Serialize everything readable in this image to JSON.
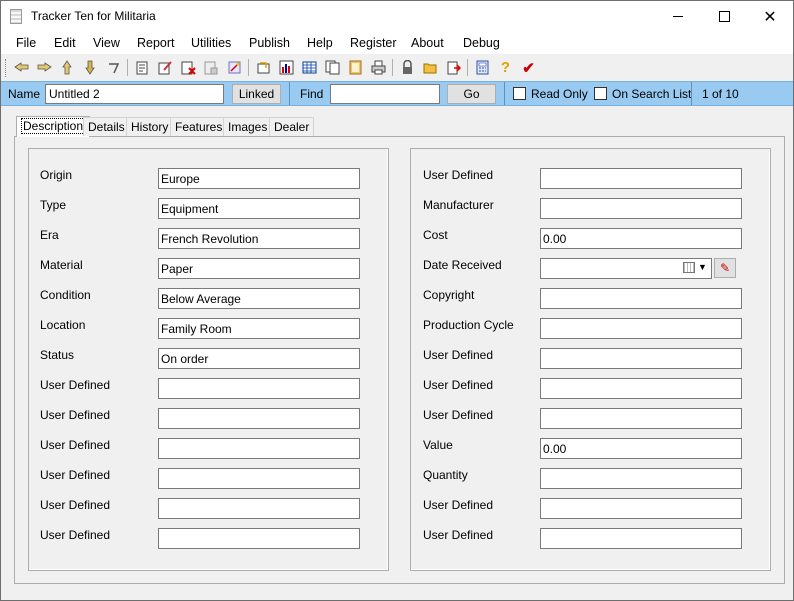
{
  "window": {
    "title": "Tracker Ten for Militaria"
  },
  "menu": [
    "File",
    "Edit",
    "View",
    "Report",
    "Utilities",
    "Publish",
    "Help",
    "Register",
    "About",
    "Debug"
  ],
  "toolbar": {
    "icons": [
      "first-record-icon",
      "previous-record-icon",
      "next-record-icon",
      "last-record-icon",
      "insert-record-icon",
      "copy-record-icon",
      "edit-record-icon",
      "delete-record-icon",
      "clear-record-icon",
      "wizard-icon",
      "import-icon",
      "chart-icon",
      "grid-icon",
      "duplicate-icon",
      "photo-icon",
      "print-icon",
      "lock-icon",
      "open-folder-icon",
      "export-icon",
      "calculator-icon",
      "help-icon",
      "check-icon"
    ],
    "colors": {
      "help": "#d9a400",
      "check": "#d00000"
    }
  },
  "search": {
    "name_label": "Name",
    "name_value": "Untitled 2",
    "linked_label": "Linked",
    "find_label": "Find",
    "find_value": "",
    "go_label": "Go",
    "read_only_label": "Read Only",
    "on_search_list_label": "On Search List",
    "record_position": "1 of 10",
    "bar_color": "#99cbf2"
  },
  "tabs": [
    "Description",
    "Details",
    "History",
    "Features",
    "Images",
    "Dealer"
  ],
  "active_tab": "Description",
  "left_fields": [
    {
      "label": "Origin",
      "value": "Europe"
    },
    {
      "label": "Type",
      "value": "Equipment"
    },
    {
      "label": "Era",
      "value": "French Revolution"
    },
    {
      "label": "Material",
      "value": "Paper"
    },
    {
      "label": "Condition",
      "value": "Below Average"
    },
    {
      "label": "Location",
      "value": "Family Room"
    },
    {
      "label": "Status",
      "value": "On order"
    },
    {
      "label": "User Defined",
      "value": ""
    },
    {
      "label": "User Defined",
      "value": ""
    },
    {
      "label": "User Defined",
      "value": ""
    },
    {
      "label": "User Defined",
      "value": ""
    },
    {
      "label": "User Defined",
      "value": ""
    },
    {
      "label": "User Defined",
      "value": ""
    }
  ],
  "right_fields": [
    {
      "label": "User Defined",
      "value": ""
    },
    {
      "label": "Manufacturer",
      "value": ""
    },
    {
      "label": "Cost",
      "value": "0.00"
    },
    {
      "label": "Date Received",
      "value": ""
    },
    {
      "label": "Copyright",
      "value": ""
    },
    {
      "label": "Production Cycle",
      "value": ""
    },
    {
      "label": "User Defined",
      "value": ""
    },
    {
      "label": "User Defined",
      "value": ""
    },
    {
      "label": "User Defined",
      "value": ""
    },
    {
      "label": "Value",
      "value": "0.00"
    },
    {
      "label": "Quantity",
      "value": ""
    },
    {
      "label": "User Defined",
      "value": ""
    },
    {
      "label": "User Defined",
      "value": ""
    }
  ]
}
